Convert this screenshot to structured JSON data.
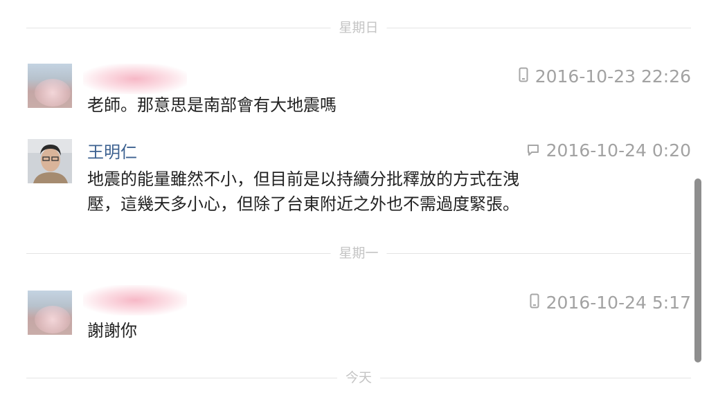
{
  "separators": {
    "sunday": "星期日",
    "monday": "星期一",
    "today": "今天"
  },
  "messages": [
    {
      "name": "",
      "device_icon": "phone-icon",
      "timestamp": "2016-10-23 22:26",
      "text": "老師。那意思是南部會有大地震嗎"
    },
    {
      "name": "王明仁",
      "device_icon": "chat-icon",
      "timestamp": "2016-10-24 0:20",
      "text_lines": [
        "地震的能量雖然不小，但目前是以持續分批釋放的方式在洩",
        "壓，這幾天多小心，但除了台東附近之外也不需過度緊張。"
      ]
    },
    {
      "name": "",
      "device_icon": "phone-icon",
      "timestamp": "2016-10-24 5:17",
      "text": "謝謝你"
    }
  ],
  "colors": {
    "name": "#3c6190",
    "timestamp": "#a2a2a2",
    "separator": "#c4c4c4",
    "text": "#222222"
  }
}
